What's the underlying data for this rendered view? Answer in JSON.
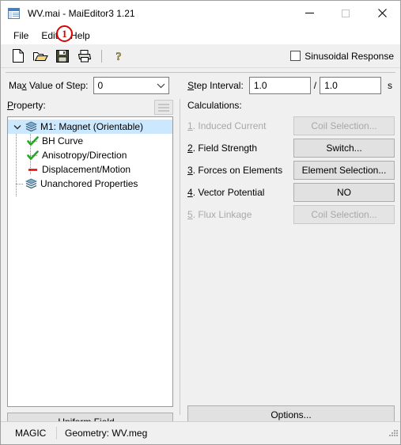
{
  "window": {
    "title": "WV.mai - MaiEditor3 1.21",
    "app_icon": "document-window-icon",
    "minimize_label": "—",
    "maximize_label": "□",
    "close_label": "✕"
  },
  "menubar": {
    "items": [
      {
        "label": "File",
        "name": "menu-file"
      },
      {
        "label": "Edit",
        "name": "menu-edit"
      },
      {
        "label": "Help",
        "name": "menu-help"
      }
    ],
    "annotation": {
      "number": "1",
      "color": "#e00000",
      "target": "menu-help"
    }
  },
  "toolbar": {
    "buttons": [
      {
        "name": "new-file-icon",
        "tooltip": "New"
      },
      {
        "name": "open-folder-icon",
        "tooltip": "Open"
      },
      {
        "name": "save-floppy-icon",
        "tooltip": "Save"
      },
      {
        "name": "print-icon",
        "tooltip": "Print"
      },
      {
        "name": "help-question-icon",
        "tooltip": "Help"
      }
    ],
    "sinusoidal_response": {
      "label": "Sinusoidal Response",
      "checked": false
    }
  },
  "step_row": {
    "max_value_label_pre": "Ma",
    "max_value_label_acc": "x",
    "max_value_label_post": " Value of Step:",
    "max_value_selected": "0",
    "step_interval_label_acc": "S",
    "step_interval_label_post": "tep Interval:",
    "interval_numerator": "1.0",
    "interval_separator": "/",
    "interval_denominator": "1.0",
    "interval_unit": "s"
  },
  "property_panel": {
    "title_acc": "P",
    "title_post": "roperty:",
    "list_button_name": "property-list-view-button",
    "tree": [
      {
        "label": "M1: Magnet (Orientable)",
        "icon": "layers-stack-icon",
        "level": 0,
        "selected": true,
        "expanded": true
      },
      {
        "label": "BH Curve",
        "icon": "green-check-icon",
        "level": 1,
        "selected": false
      },
      {
        "label": "Anisotropy/Direction",
        "icon": "green-check-icon",
        "level": 1,
        "selected": false
      },
      {
        "label": "Displacement/Motion",
        "icon": "red-dash-icon",
        "level": 1,
        "selected": false
      },
      {
        "label": "Unanchored Properties",
        "icon": "layers-stack-icon",
        "level": 0,
        "selected": false
      }
    ],
    "uniform_field_button": "Uniform Field..."
  },
  "calculations_panel": {
    "title": "Calculations:",
    "rows": [
      {
        "num": "1",
        "label": ". Induced Current",
        "button": "Coil Selection...",
        "disabled": true
      },
      {
        "num": "2",
        "label": ". Field Strength",
        "button": "Switch...",
        "disabled": false
      },
      {
        "num": "3",
        "label": ". Forces on Elements",
        "button": "Element Selection...",
        "disabled": false
      },
      {
        "num": "4",
        "label": ". Vector Potential",
        "button": "NO",
        "disabled": false
      },
      {
        "num": "5",
        "label": ". Flux Linkage",
        "button": "Coil Selection...",
        "disabled": true
      }
    ],
    "options_button": "Options..."
  },
  "statusbar": {
    "left": "MAGIC",
    "right": "Geometry: WV.meg"
  },
  "colors": {
    "accent_selection": "#cce8ff",
    "annotation_red": "#e00000",
    "check_green": "#1faa1f",
    "dash_red": "#e01010",
    "window_bg": "#f0f0f0"
  }
}
